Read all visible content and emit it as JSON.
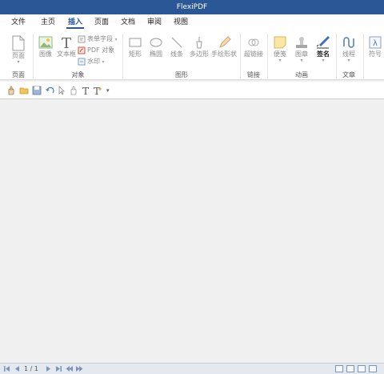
{
  "window": {
    "title": "FlexiPDF"
  },
  "menu": {
    "items": [
      "文件",
      "主页",
      "插入",
      "页面",
      "文档",
      "审阅",
      "视图"
    ],
    "active": "插入"
  },
  "ribbon": {
    "page": {
      "label": "页面",
      "group": "页面"
    },
    "object": {
      "image": "图像",
      "textbox": "文本框",
      "form_field": "表单字段",
      "pdf_object": "PDF 对象",
      "watermark": "水印",
      "group": "对象"
    },
    "shapes": {
      "rect": "矩形",
      "ellipse": "椭圆",
      "line": "线条",
      "polygon": "多边形",
      "freehand": "手绘形状",
      "group": "图形"
    },
    "link": {
      "hyperlink": "超链接",
      "group": "链接"
    },
    "comment": {
      "note": "便笺",
      "stamp": "图章",
      "signature": "签名",
      "group": "动画"
    },
    "article": {
      "thread": "线程",
      "group": "文章"
    },
    "symbol": {
      "label": "符号"
    }
  },
  "statusbar": {
    "page_info": "1 / 1"
  },
  "colors": {
    "title_bar": "#2b5797",
    "accent": "#2b5797"
  }
}
